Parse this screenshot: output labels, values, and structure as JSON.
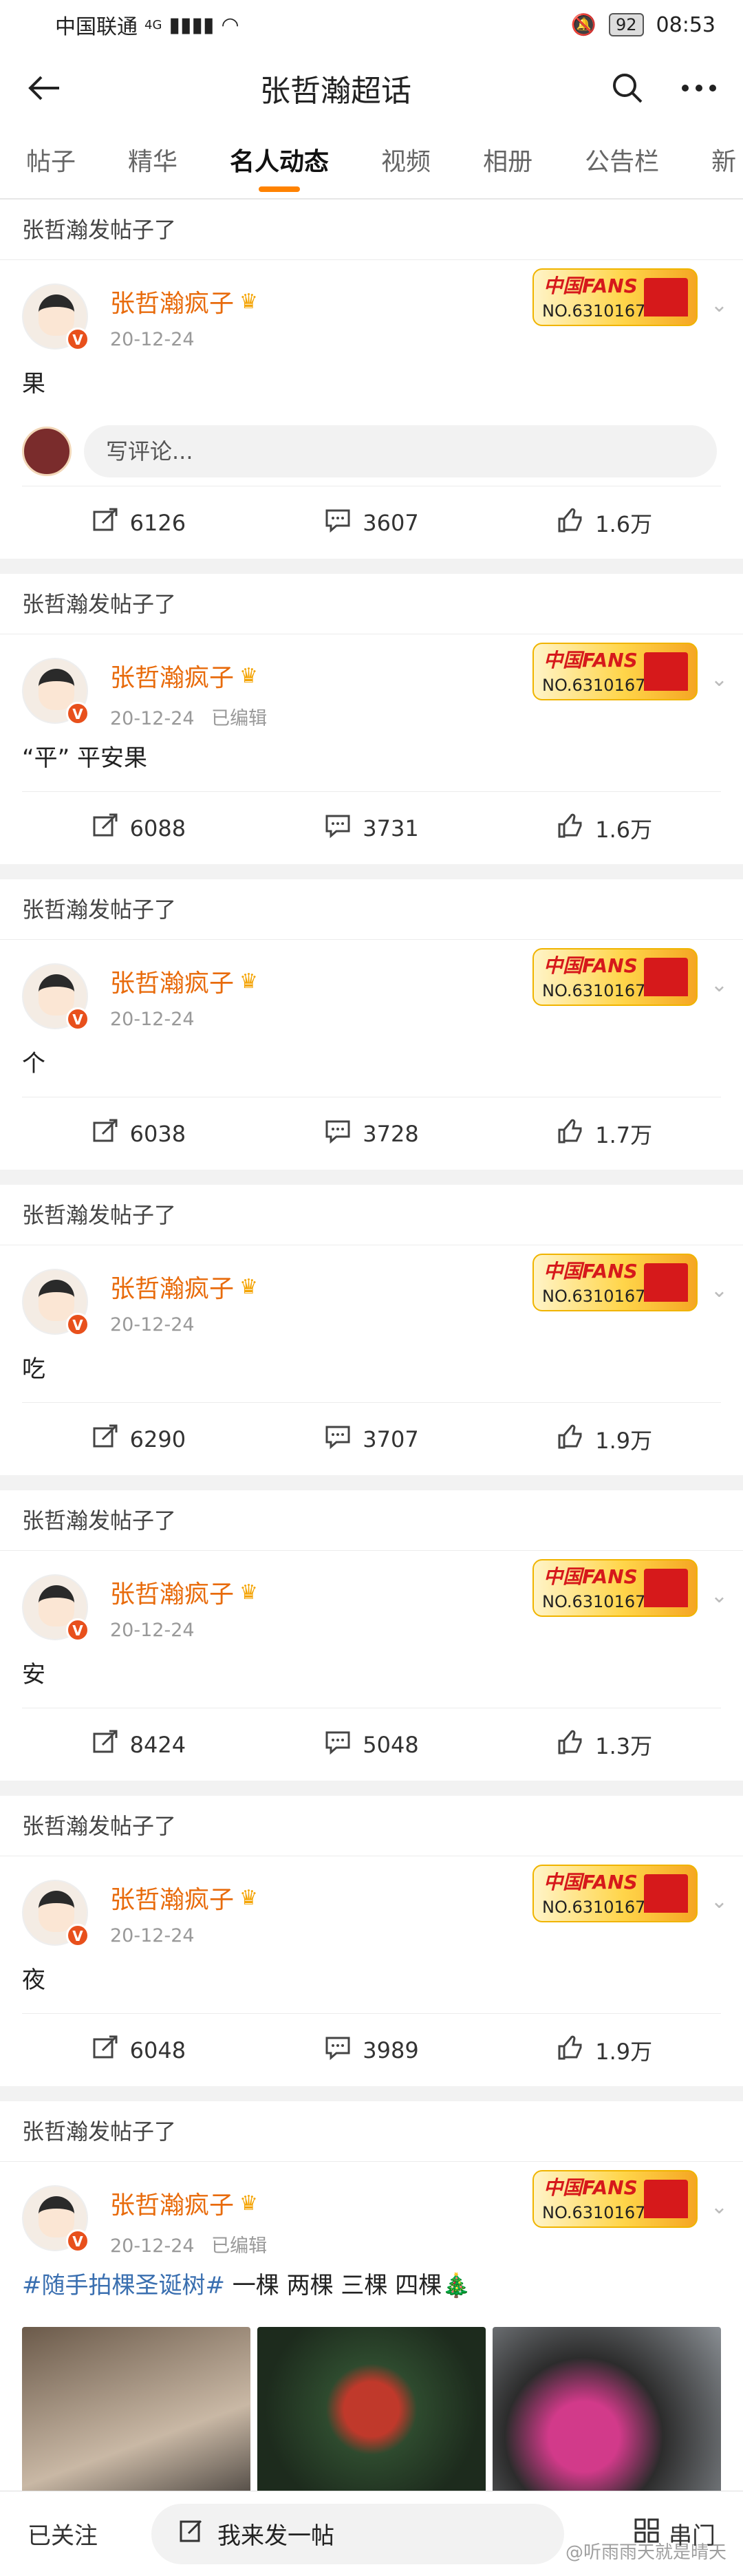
{
  "status": {
    "carrier": "中国联通",
    "signal": "4G",
    "battery": "92",
    "time": "08:53"
  },
  "nav": {
    "title": "张哲瀚超话"
  },
  "tabs": [
    "帖子",
    "精华",
    "名人动态",
    "视频",
    "相册",
    "公告栏",
    "新"
  ],
  "active_tab": "名人动态",
  "card_header": "张哲瀚发帖子了",
  "author": {
    "name": "张哲瀚疯子",
    "fans_title": "中国FANS",
    "fans_no": "NO.6310167"
  },
  "comment_placeholder": "写评论...",
  "posts": [
    {
      "date": "20-12-24",
      "edited": "",
      "content": "果",
      "reposts": "6126",
      "comments": "3607",
      "likes": "1.6万"
    },
    {
      "date": "20-12-24",
      "edited": "已编辑",
      "content": "“平” 平安果",
      "reposts": "6088",
      "comments": "3731",
      "likes": "1.6万"
    },
    {
      "date": "20-12-24",
      "edited": "",
      "content": "个",
      "reposts": "6038",
      "comments": "3728",
      "likes": "1.7万"
    },
    {
      "date": "20-12-24",
      "edited": "",
      "content": "吃",
      "reposts": "6290",
      "comments": "3707",
      "likes": "1.9万"
    },
    {
      "date": "20-12-24",
      "edited": "",
      "content": "安",
      "reposts": "8424",
      "comments": "5048",
      "likes": "1.3万"
    },
    {
      "date": "20-12-24",
      "edited": "",
      "content": "夜",
      "reposts": "6048",
      "comments": "3989",
      "likes": "1.9万"
    },
    {
      "date": "20-12-24",
      "edited": "已编辑",
      "content_tag": "#随手拍棵圣诞树#",
      "content": " 一棵 两棵 三棵 四棵🎄"
    }
  ],
  "bottom": {
    "followed": "已关注",
    "post_button": "我来发一帖",
    "chuanmen": "串门"
  },
  "watermark": "@听雨雨天就是晴天"
}
